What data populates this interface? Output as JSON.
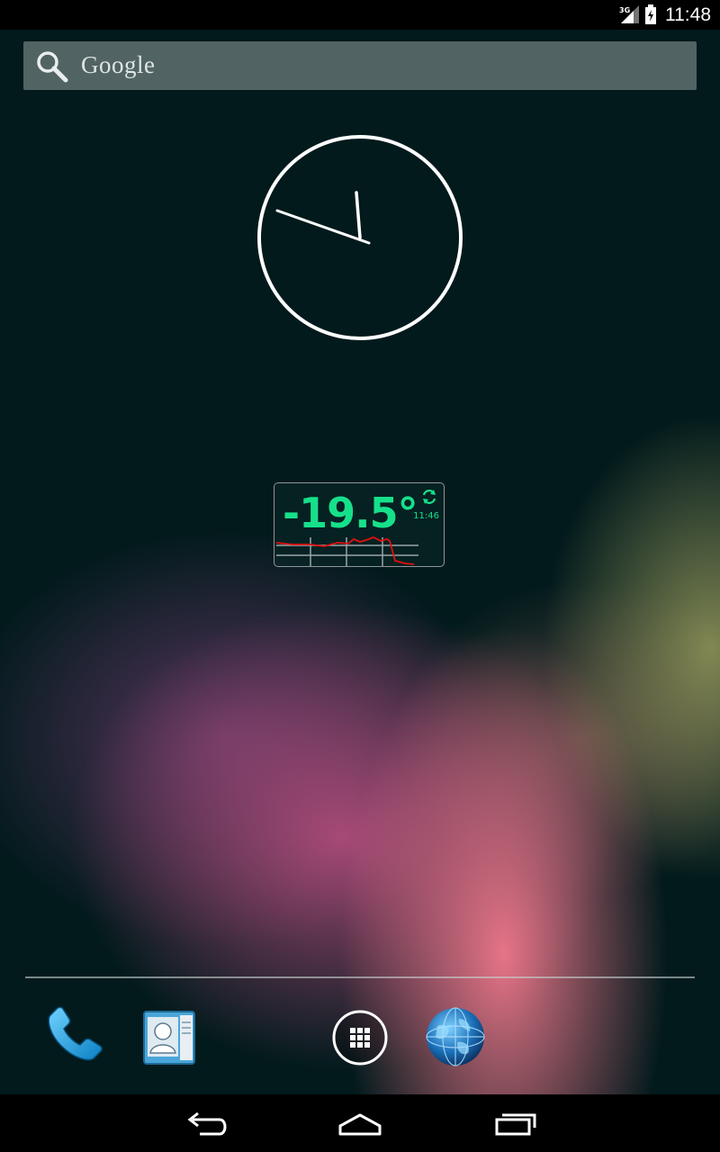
{
  "status_bar": {
    "network": "3G",
    "time": "11:48"
  },
  "search": {
    "placeholder": "Google"
  },
  "clock": {
    "hour_hand_target": "11",
    "minute_hand_target": "48"
  },
  "temperature_widget": {
    "value": "-19.5°",
    "updated_time": "11:46",
    "color": "#16e08a",
    "graph_color": "#e01010"
  },
  "dock": {
    "apps": [
      "phone-icon",
      "contacts-icon",
      "all-apps-icon",
      "browser-icon"
    ]
  },
  "nav": {
    "buttons": [
      "back-icon",
      "home-icon",
      "recent-apps-icon"
    ]
  }
}
